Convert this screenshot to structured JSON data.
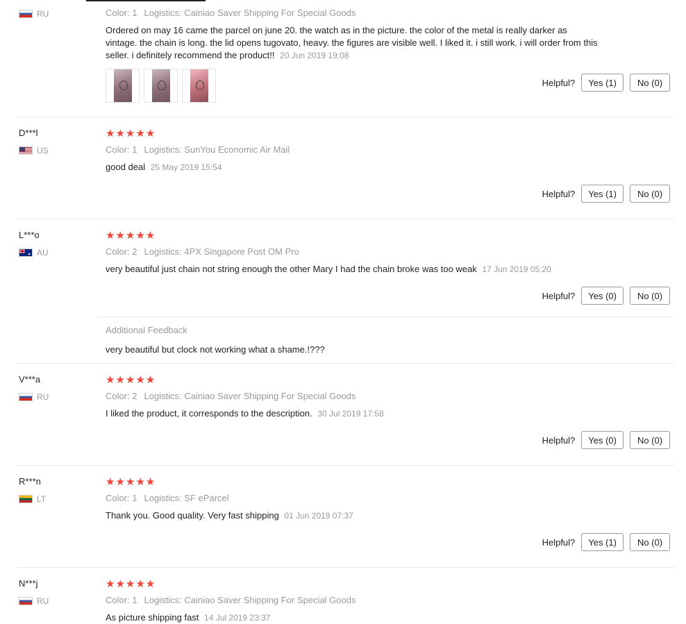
{
  "top_review": {
    "country": "RU",
    "color": "Color: 1",
    "logistics": "Logistics: Cainiao Saver Shipping For Special Goods",
    "text": "Ordered on may 16 came the parcel on june 20. the watch as in the picture. the color of the metal is really darker as vintage. the chain is long. the lid opens tugovato, heavy. the figures are visible well. I liked it. i still work. i will order from this seller. i definitely recommend the product!!",
    "date": "20 Jun 2019 19:08",
    "helpful_label": "Helpful?",
    "yes_label": "Yes (1)",
    "no_label": "No (0)"
  },
  "reviews": [
    {
      "user": "D***l",
      "country": "US",
      "stars": "★★★★★",
      "color": "Color: 1",
      "logistics": "Logistics: SunYou Economic Air Mail",
      "text": "good deal",
      "date": "25 May 2019 15:54",
      "helpful_label": "Helpful?",
      "yes_label": "Yes (1)",
      "no_label": "No (0)"
    },
    {
      "user": "L***o",
      "country": "AU",
      "stars": "★★★★★",
      "color": "Color: 2",
      "logistics": "Logistics: 4PX Singapore Post OM Pro",
      "text": "very beautiful just chain not string enough the other Mary I had the chain broke was too weak",
      "date": "17 Jun 2019 05:20",
      "helpful_label": "Helpful?",
      "yes_label": "Yes (0)",
      "no_label": "No (0)",
      "additional_feedback_label": "Additional Feedback",
      "additional_feedback": "very beautiful but clock not working what a shame.!???"
    },
    {
      "user": "V***a",
      "country": "RU",
      "stars": "★★★★★",
      "color": "Color: 2",
      "logistics": "Logistics: Cainiao Saver Shipping For Special Goods",
      "text": "I liked the product, it corresponds to the description.",
      "date": "30 Jul 2019 17:58",
      "helpful_label": "Helpful?",
      "yes_label": "Yes (0)",
      "no_label": "No (0)"
    },
    {
      "user": "R***n",
      "country": "LT",
      "stars": "★★★★★",
      "color": "Color: 1",
      "logistics": "Logistics: SF eParcel",
      "text": "Thank you. Good quality. Very fast shipping",
      "date": "01 Jun 2019 07:37",
      "helpful_label": "Helpful?",
      "yes_label": "Yes (1)",
      "no_label": "No (0)"
    },
    {
      "user": "N***j",
      "country": "RU",
      "stars": "★★★★★",
      "color": "Color: 1",
      "logistics": "Logistics: Cainiao Saver Shipping For Special Goods",
      "text": "As picture shipping fast",
      "date": "14 Jul 2019 23:37"
    }
  ],
  "colors": {
    "star": "#f44336",
    "muted_text": "#999999",
    "separator": "#e8e8e8"
  },
  "icons": {
    "rating": "star-icon",
    "thumbnail": "photo-thumbnail"
  }
}
